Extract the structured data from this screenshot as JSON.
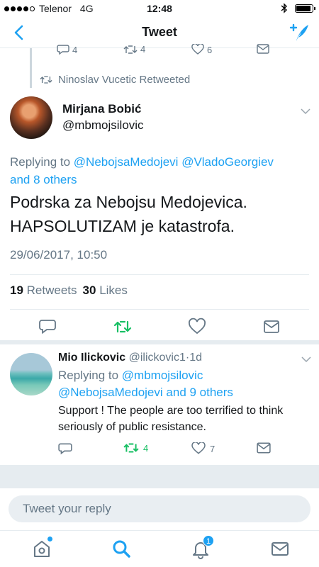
{
  "status_bar": {
    "carrier": "Telenor",
    "network": "4G",
    "time": "12:48"
  },
  "nav": {
    "title": "Tweet"
  },
  "previous_tweet": {
    "reply_count": "4",
    "retweet_count": "4",
    "like_count": "6"
  },
  "retweet_context": "Ninoslav Vucetic Retweeted",
  "main_tweet": {
    "author_name": "Mirjana Bobić",
    "author_handle": "@mbmojsilovic",
    "replying_prefix": "Replying to ",
    "replying_user1": "@NebojsaMedojevi",
    "replying_user2": "@VladoGeorgiev",
    "replying_others": "and 8 others",
    "text_line1": "Podrska za Nebojsu Medojevica.",
    "text_line2": "HAPSOLUTIZAM je katastrofa.",
    "timestamp": "29/06/2017, 10:50",
    "retweets_count": "19",
    "retweets_label": "Retweets",
    "likes_count": "30",
    "likes_label": "Likes"
  },
  "reply_tweet": {
    "author_name": "Mio Ilickovic",
    "author_handle": "@ilickovic1",
    "separator": "·",
    "age": "1d",
    "replying_prefix": "Replying to ",
    "replying_user1": "@mbmojsilovic",
    "replying_user2": "@NebojsaMedojevi",
    "replying_others": "and 9 others",
    "text": "Support ! The  people are  too terrified to think  seriously of public resistance.",
    "retweet_count": "4",
    "like_count": "7"
  },
  "reply_box": {
    "placeholder": "Tweet your reply"
  },
  "tabbar": {
    "notifications_badge": "1"
  },
  "colors": {
    "accent": "#1da1f2",
    "retweet_green": "#17bf63",
    "muted": "#657786"
  }
}
